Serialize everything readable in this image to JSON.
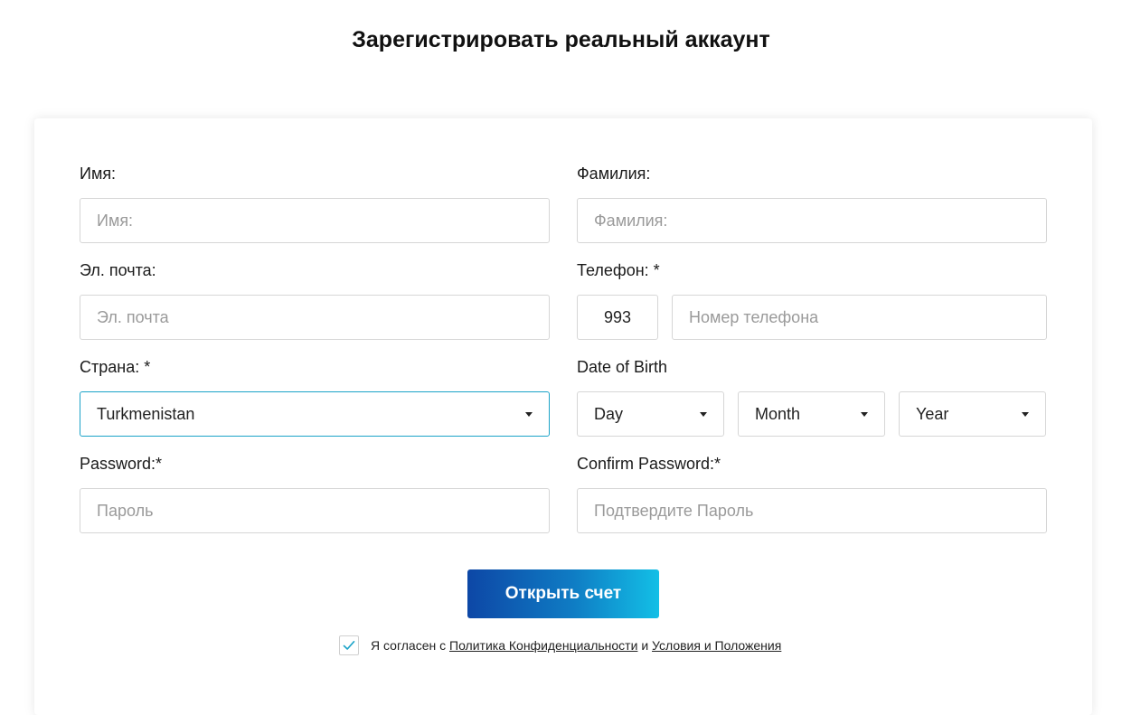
{
  "page": {
    "title": "Зарегистрировать реальный аккаунт"
  },
  "form": {
    "first_name": {
      "label": "Имя:",
      "placeholder": "Имя:"
    },
    "last_name": {
      "label": "Фамилия:",
      "placeholder": "Фамилия:"
    },
    "email": {
      "label": "Эл. почта:",
      "placeholder": "Эл. почта"
    },
    "phone": {
      "label": "Телефон: *",
      "code": "993",
      "placeholder": "Номер телефона"
    },
    "country": {
      "label": "Страна: *",
      "value": "Turkmenistan"
    },
    "dob": {
      "label": "Date of Birth",
      "day": "Day",
      "month": "Month",
      "year": "Year"
    },
    "password": {
      "label": "Password:*",
      "placeholder": "Пароль"
    },
    "confirm_password": {
      "label": "Confirm Password:*",
      "placeholder": "Подтвердите Пароль"
    },
    "submit_label": "Открыть счет",
    "agree": {
      "checked": true,
      "prefix": "Я согласен с",
      "privacy_link": "Политика Конфиденциальности",
      "conjunction": "и",
      "terms_link": "Условия и Положения"
    }
  },
  "colors": {
    "accent_focus": "#1ba3c8",
    "button_gradient_start": "#0d47a6",
    "button_gradient_end": "#13bfe6",
    "check_color": "#1ba3c8"
  },
  "icons": {
    "dropdown": "caret-down-icon",
    "check": "checkmark-icon"
  }
}
